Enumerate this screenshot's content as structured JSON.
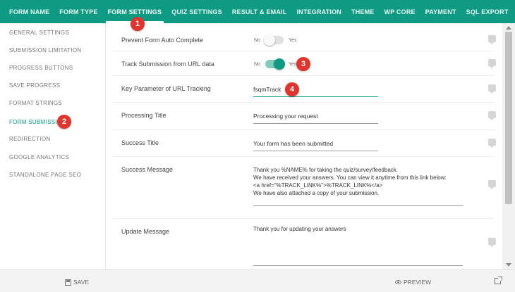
{
  "tabs": [
    {
      "label": "Form Name",
      "active": false
    },
    {
      "label": "Form Type",
      "active": false
    },
    {
      "label": "Form Settings",
      "active": true
    },
    {
      "label": "Quiz Settings",
      "active": false
    },
    {
      "label": "Result & Email",
      "active": false
    },
    {
      "label": "Integration",
      "active": false
    },
    {
      "label": "Theme",
      "active": false
    },
    {
      "label": "WP Core",
      "active": false
    },
    {
      "label": "Payment",
      "active": false
    },
    {
      "label": "SQL Export",
      "active": false
    }
  ],
  "sidebar": {
    "items": [
      {
        "label": "General Settings",
        "active": false
      },
      {
        "label": "Submission Limitation",
        "active": false
      },
      {
        "label": "Progress Buttons",
        "active": false
      },
      {
        "label": "Save Progress",
        "active": false
      },
      {
        "label": "Format Strings",
        "active": false
      },
      {
        "label": "Form Submission",
        "active": true
      },
      {
        "label": "Redirection",
        "active": false
      },
      {
        "label": "Google Analytics",
        "active": false
      },
      {
        "label": "Standalone Page SEO",
        "active": false
      }
    ]
  },
  "settings": {
    "autocomplete": {
      "label": "Prevent Form Auto Complete",
      "no": "No",
      "yes": "Yes",
      "enabled": false
    },
    "track_url": {
      "label": "Track Submission from URL data",
      "no": "No",
      "yes": "Yes",
      "enabled": true
    },
    "key_param": {
      "label": "Key Parameter of URL Tracking",
      "value": "fsqmTrack"
    },
    "processing_title": {
      "label": "Processing Title",
      "value": "Processing your request"
    },
    "success_title": {
      "label": "Success Title",
      "value": "Your form has been submitted"
    },
    "success_message": {
      "label": "Success Message",
      "lines": [
        "Thank you %NAME% for taking the quiz/survey/feedback.",
        "We have received your answers. You can view it anytime from this link below:",
        "<a href=\"%TRACK_LINK%\">%TRACK_LINK%</a>",
        "We have also attached a copy of your submission."
      ]
    },
    "update_message": {
      "label": "Update Message",
      "value": "Thank you for updating your answers"
    }
  },
  "annotations": [
    "1",
    "2",
    "3",
    "4"
  ],
  "footer": {
    "save_label": "Save",
    "preview_label": "Preview"
  },
  "icons": [
    "save-icon",
    "eye-icon",
    "external-link-icon",
    "help-icon"
  ],
  "colors": {
    "accent": "#0f9a84",
    "annotation": "#e0352f"
  }
}
